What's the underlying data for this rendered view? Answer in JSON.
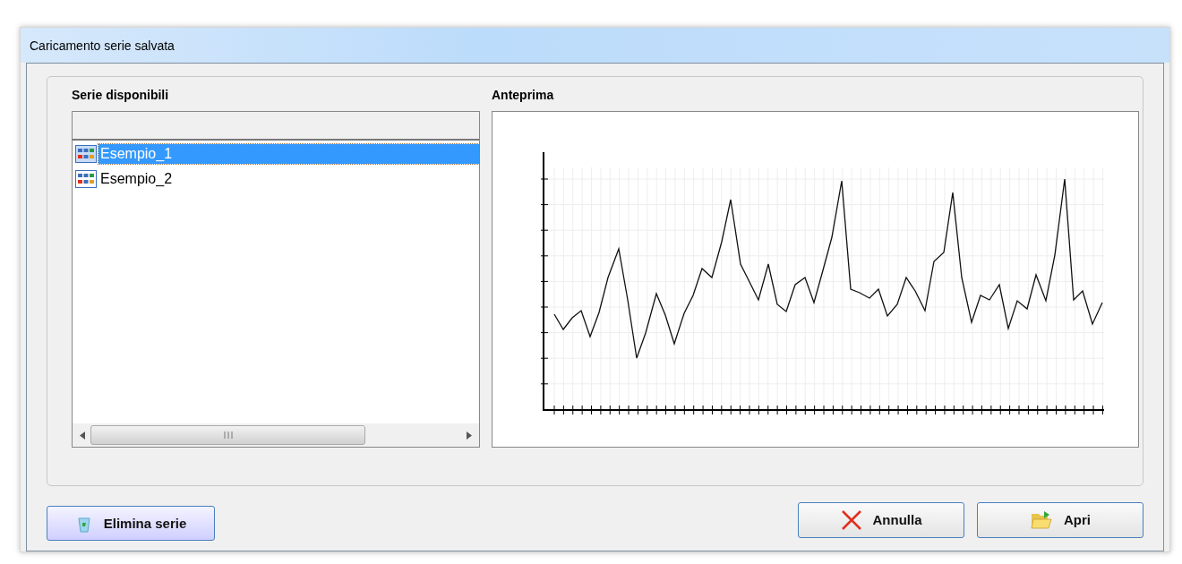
{
  "window": {
    "title": "Caricamento serie salvata"
  },
  "series_list": {
    "heading": "Serie disponibili",
    "items": [
      {
        "label": "Esempio_1",
        "selected": true
      },
      {
        "label": "Esempio_2",
        "selected": false
      }
    ]
  },
  "preview": {
    "heading": "Anteprima"
  },
  "buttons": [
    {
      "label": "Elimina serie",
      "kind": "delete"
    },
    {
      "label": "Annulla",
      "kind": "cancel"
    },
    {
      "label": "Apri",
      "kind": "open"
    }
  ]
}
